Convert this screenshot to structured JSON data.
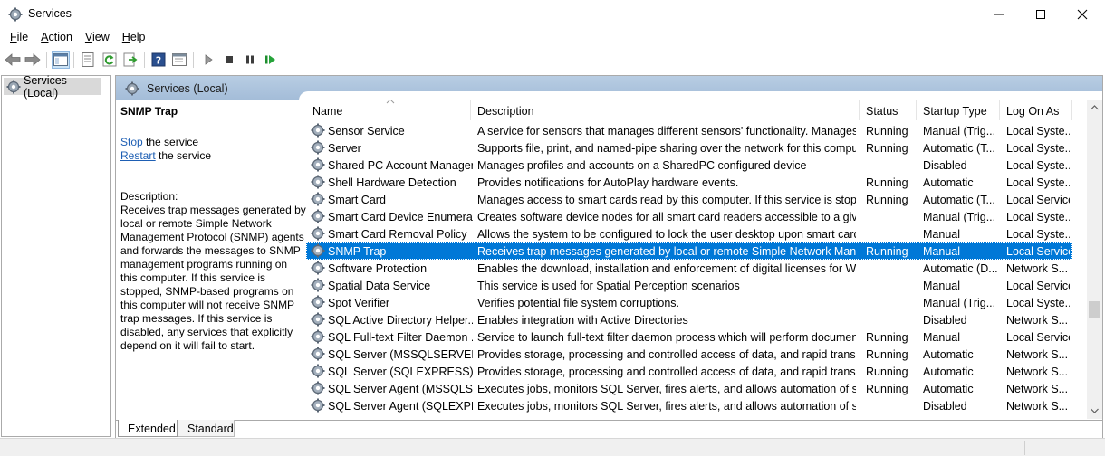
{
  "window": {
    "title": "Services"
  },
  "menu": [
    {
      "label": "File",
      "accel": "F",
      "rest": "ile"
    },
    {
      "label": "Action",
      "accel": "A",
      "rest": "ction"
    },
    {
      "label": "View",
      "accel": "V",
      "rest": "iew"
    },
    {
      "label": "Help",
      "accel": "H",
      "rest": "elp"
    }
  ],
  "toolbar": {
    "icons": [
      "back-arrow-icon",
      "forward-arrow-icon",
      "show-hide-console-tree-icon",
      "properties-icon",
      "refresh-icon",
      "export-list-icon",
      "help-icon",
      "show-hide-action-pane-icon",
      "start-service-icon",
      "stop-service-icon",
      "pause-service-icon",
      "resume-service-icon"
    ]
  },
  "tree": {
    "root_label": "Services (Local)"
  },
  "pane": {
    "header": "Services (Local)"
  },
  "details": {
    "service_name": "SNMP Trap",
    "stop_link": "Stop",
    "stop_rest": " the service",
    "restart_link": "Restart",
    "restart_rest": " the service",
    "description_label": "Description:",
    "description": "Receives trap messages generated by local or remote Simple Network Management Protocol (SNMP) agents and forwards the messages to SNMP management programs running on this computer. If this service is stopped, SNMP-based programs on this computer will not receive SNMP trap messages. If this service is disabled, any services that explicitly depend on it will fail to start."
  },
  "columns": {
    "name": "Name",
    "description": "Description",
    "status": "Status",
    "startup": "Startup Type",
    "logon": "Log On As"
  },
  "rows": [
    {
      "name": "Sensor Service",
      "description": "A service for sensors that manages different sensors' functionality. Manages S...",
      "status": "Running",
      "startup": "Manual (Trig...",
      "logon": "Local Syste..."
    },
    {
      "name": "Server",
      "description": "Supports file, print, and named-pipe sharing over the network for this compu...",
      "status": "Running",
      "startup": "Automatic (T...",
      "logon": "Local Syste..."
    },
    {
      "name": "Shared PC Account Manager",
      "description": "Manages profiles and accounts on a SharedPC configured device",
      "status": "",
      "startup": "Disabled",
      "logon": "Local Syste..."
    },
    {
      "name": "Shell Hardware Detection",
      "description": "Provides notifications for AutoPlay hardware events.",
      "status": "Running",
      "startup": "Automatic",
      "logon": "Local Syste..."
    },
    {
      "name": "Smart Card",
      "description": "Manages access to smart cards read by this computer. If this service is stoppe...",
      "status": "Running",
      "startup": "Automatic (T...",
      "logon": "Local Service"
    },
    {
      "name": "Smart Card Device Enumera...",
      "description": "Creates software device nodes for all smart card readers accessible to a given ...",
      "status": "",
      "startup": "Manual (Trig...",
      "logon": "Local Syste..."
    },
    {
      "name": "Smart Card Removal Policy",
      "description": "Allows the system to be configured to lock the user desktop upon smart card ...",
      "status": "",
      "startup": "Manual",
      "logon": "Local Syste..."
    },
    {
      "name": "SNMP Trap",
      "description": "Receives trap messages generated by local or remote Simple Network Manag...",
      "status": "Running",
      "startup": "Manual",
      "logon": "Local Service",
      "selected": true
    },
    {
      "name": "Software Protection",
      "description": "Enables the download, installation and enforcement of digital licenses for Wi...",
      "status": "",
      "startup": "Automatic (D...",
      "logon": "Network S..."
    },
    {
      "name": "Spatial Data Service",
      "description": "This service is used for Spatial Perception scenarios",
      "status": "",
      "startup": "Manual",
      "logon": "Local Service"
    },
    {
      "name": "Spot Verifier",
      "description": "Verifies potential file system corruptions.",
      "status": "",
      "startup": "Manual (Trig...",
      "logon": "Local Syste..."
    },
    {
      "name": "SQL Active Directory Helper...",
      "description": "Enables integration with Active Directories",
      "status": "",
      "startup": "Disabled",
      "logon": "Network S..."
    },
    {
      "name": "SQL Full-text Filter Daemon ...",
      "description": "Service to launch full-text filter daemon process which will perform documen...",
      "status": "Running",
      "startup": "Manual",
      "logon": "Local Service"
    },
    {
      "name": "SQL Server (MSSQLSERVER)",
      "description": "Provides storage, processing and controlled access of data, and rapid transact...",
      "status": "Running",
      "startup": "Automatic",
      "logon": "Network S..."
    },
    {
      "name": "SQL Server (SQLEXPRESS)",
      "description": "Provides storage, processing and controlled access of data, and rapid transact...",
      "status": "Running",
      "startup": "Automatic",
      "logon": "Network S..."
    },
    {
      "name": "SQL Server Agent (MSSQLS...",
      "description": "Executes jobs, monitors SQL Server, fires alerts, and allows automation of so...",
      "status": "Running",
      "startup": "Automatic",
      "logon": "Network S..."
    },
    {
      "name": "SQL Server Agent (SQLEXPR...",
      "description": "Executes jobs, monitors SQL Server, fires alerts, and allows automation of so...",
      "status": "",
      "startup": "Disabled",
      "logon": "Network S..."
    }
  ],
  "tabs": {
    "extended": "Extended",
    "standard": "Standard"
  },
  "colors": {
    "selection": "#0078d7",
    "header": "#a3bcd8",
    "link": "#1e5fb4"
  }
}
